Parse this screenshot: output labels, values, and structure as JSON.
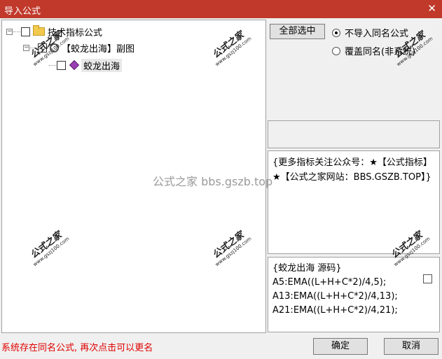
{
  "window": {
    "title": "导入公式",
    "close_glyph": "✕"
  },
  "tree": {
    "root": {
      "expander": "−",
      "label": "技术指标公式"
    },
    "child": {
      "expander": "−",
      "label": "【蛟龙出海】副图"
    },
    "leaf": {
      "label": "蛟龙出海"
    }
  },
  "options": {
    "select_all_button": "全部选中",
    "radio_no_import": "不导入同名公式",
    "radio_overwrite": "覆盖同名(非系统)"
  },
  "info_text": "{更多指标关注公众号：★【公式指标】★【公式之家网站：BBS.GSZB.TOP】}",
  "source": {
    "header": "{蛟龙出海 源码}",
    "lines": [
      "A5:EMA((L+H+C*2)/4,5);",
      "A13:EMA((L+H+C*2)/4,13);",
      "A21:EMA((L+H+C*2)/4,21);"
    ]
  },
  "footer": {
    "status": "系统存在同名公式, 再次点击可以更名",
    "ok_button": "确定",
    "cancel_button": "取消"
  },
  "watermark_text": "公式之家 bbs.gszb.top",
  "stamp": {
    "big": "公式之家",
    "small": "www.gszj100.com"
  },
  "colors": {
    "titlebar": "#c0392b",
    "status_text": "#e00000"
  }
}
